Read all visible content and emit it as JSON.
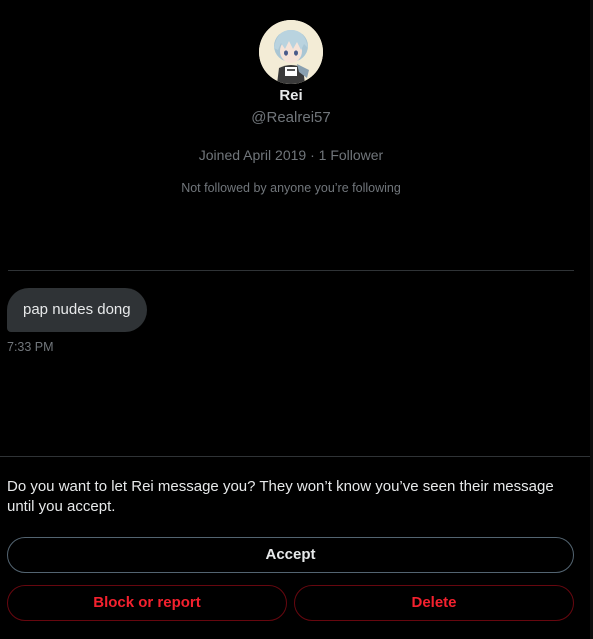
{
  "profile": {
    "avatar_icon": "anime-avatar-icon",
    "display_name": "Rei",
    "handle": "@Realrei57",
    "joined": "Joined April 2019",
    "separator": " · ",
    "followers": "1 Follower",
    "not_followed_note": "Not followed by anyone you’re following"
  },
  "conversation": {
    "messages": [
      {
        "text": "pap nudes dong",
        "time": "7:33 PM"
      }
    ]
  },
  "request": {
    "prompt": "Do you want to let Rei message you? They won’t know you’ve seen their message until you accept.",
    "accept_label": "Accept",
    "block_label": "Block or report",
    "delete_label": "Delete"
  },
  "colors": {
    "background": "#000000",
    "primary_text": "#e7e9ea",
    "secondary_text": "#71767b",
    "bubble": "#2f3336",
    "danger": "#f4212e",
    "danger_border": "#67070f",
    "divider": "#2f3336"
  }
}
